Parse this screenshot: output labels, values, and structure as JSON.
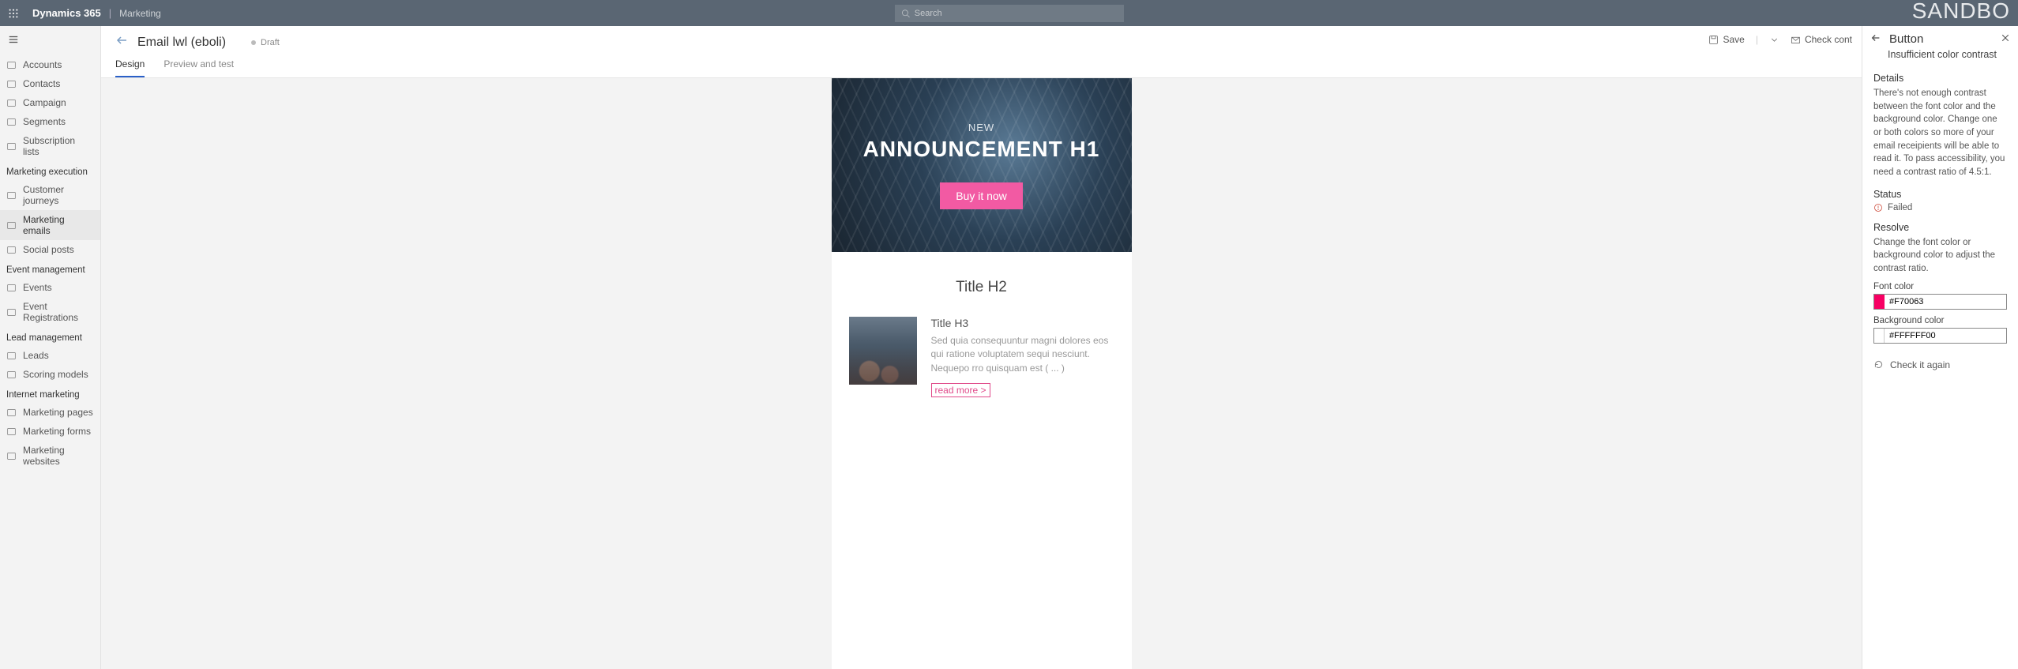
{
  "topbar": {
    "brand": "Dynamics 365",
    "sub": "Marketing",
    "search_placeholder": "Search",
    "sandbox": "SANDBO"
  },
  "sidebar": {
    "items_top": [
      {
        "label": "Accounts"
      },
      {
        "label": "Contacts"
      },
      {
        "label": "Campaign"
      },
      {
        "label": "Segments"
      },
      {
        "label": "Subscription lists"
      }
    ],
    "groups": [
      {
        "title": "Marketing execution",
        "items": [
          {
            "label": "Customer journeys"
          },
          {
            "label": "Marketing emails",
            "active": true
          },
          {
            "label": "Social posts"
          }
        ]
      },
      {
        "title": "Event management",
        "items": [
          {
            "label": "Events"
          },
          {
            "label": "Event Registrations"
          }
        ]
      },
      {
        "title": "Lead management",
        "items": [
          {
            "label": "Leads"
          },
          {
            "label": "Scoring models"
          }
        ]
      },
      {
        "title": "Internet marketing",
        "items": [
          {
            "label": "Marketing pages"
          },
          {
            "label": "Marketing forms"
          },
          {
            "label": "Marketing websites"
          }
        ]
      }
    ]
  },
  "header": {
    "title": "Email lwl (eboli)",
    "status": "Draft",
    "save": "Save",
    "check": "Check cont"
  },
  "tabs": {
    "design": "Design",
    "preview": "Preview and test"
  },
  "email": {
    "eyebrow": "NEW",
    "h1": "ANNOUNCEMENT H1",
    "cta": "Buy it now",
    "h2": "Title H2",
    "h3": "Title H3",
    "body": "Sed quia consequuntur magni dolores eos qui ratione voluptatem sequi nesciunt. Nequepo rro quisquam est ( ... )",
    "readmore": "read more >"
  },
  "panel": {
    "title": "Button",
    "subtitle": "Insufficient color contrast",
    "details_h": "Details",
    "details_p": "There's not enough contrast between the font color and the background color. Change one or both colors so more of your email receipients will be able to read it. To pass accessibility, you need a contrast ratio of 4.5:1.",
    "status_h": "Status",
    "status_v": "Failed",
    "resolve_h": "Resolve",
    "resolve_p": "Change the font color or background color to adjust the contrast ratio.",
    "font_label": "Font color",
    "font_value": "#F70063",
    "font_swatch": "#F70063",
    "bg_label": "Background color",
    "bg_value": "#FFFFFF00",
    "bg_swatch": "#FFFFFF",
    "check_again": "Check it again"
  }
}
